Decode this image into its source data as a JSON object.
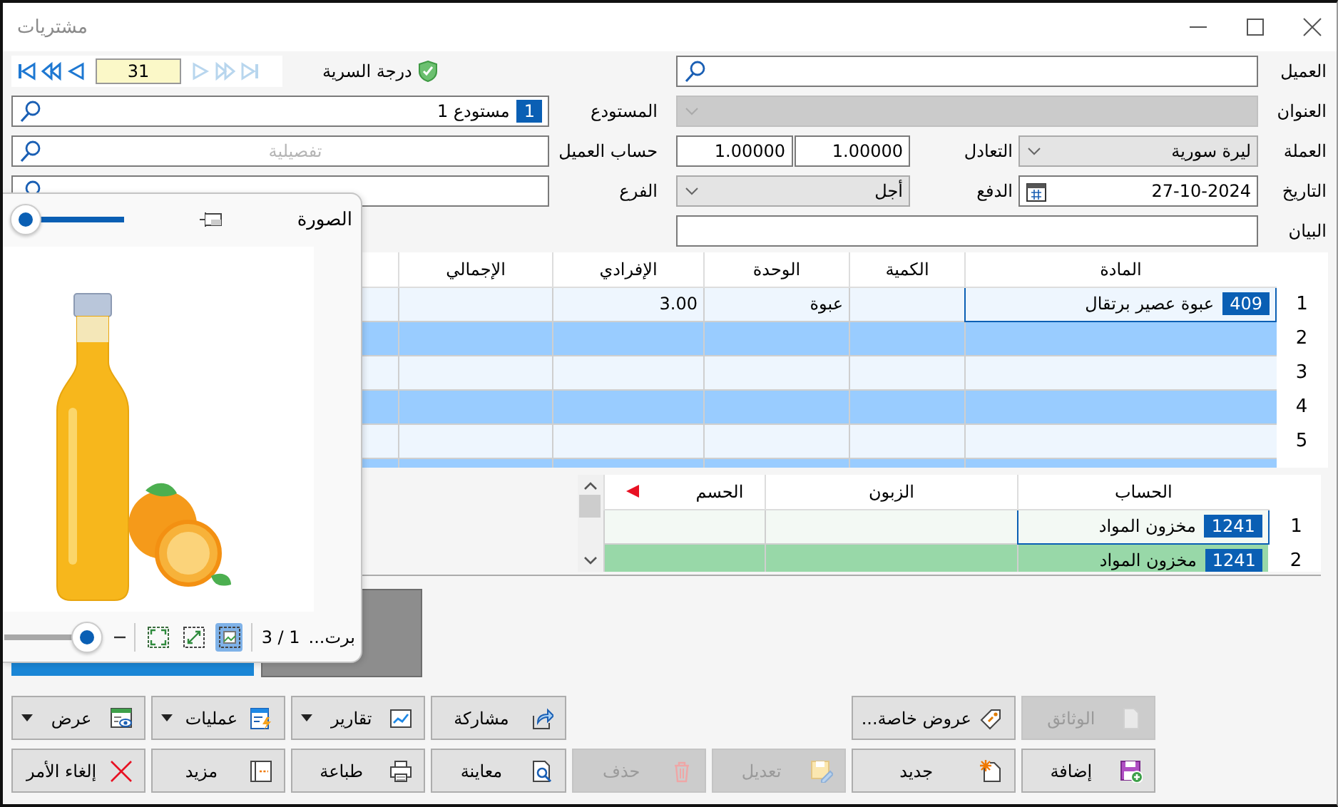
{
  "window": {
    "title": "مشتريات"
  },
  "navigator": {
    "record": "31",
    "back_disabled": false,
    "forward_disabled": true
  },
  "security": {
    "label": "درجة السرية"
  },
  "left_fields": [
    {
      "kind": "lookup",
      "label": "المستودع",
      "badge": "1",
      "value": "مستودع 1"
    },
    {
      "kind": "lookup",
      "label": "حساب العميل",
      "placeholder": "تفصيلية"
    },
    {
      "kind": "lookup",
      "label": "الفرع"
    }
  ],
  "right_rows": [
    {
      "fields": [
        {
          "kind": "lookup",
          "label": "العميل"
        }
      ]
    },
    {
      "fields": [
        {
          "kind": "combo",
          "label": "العنوان",
          "disabled": true
        }
      ]
    },
    {
      "fields": [
        {
          "kind": "combo",
          "label": "العملة",
          "value": "ليرة سورية",
          "disabled": false
        },
        {
          "kind": "pair",
          "label": "التعادل",
          "values": [
            "1.00000",
            "1.00000"
          ]
        }
      ]
    },
    {
      "fields": [
        {
          "kind": "date",
          "label": "التاريخ",
          "value": "27-10-2024"
        },
        {
          "kind": "combo",
          "label": "الدفع",
          "value": "أجل",
          "disabled": false
        }
      ]
    },
    {
      "fields": [
        {
          "kind": "text",
          "label": "البيان"
        }
      ]
    }
  ],
  "items_table": {
    "columns": [
      "المادة",
      "الكمية",
      "الوحدة",
      "الإفرادي",
      "الإجمالي"
    ],
    "rows": [
      {
        "number": "1",
        "selected": true,
        "item": {
          "code": "409",
          "name": "عبوة عصير برتقال"
        },
        "unit": "عبوة",
        "unit_price": "3.00"
      },
      {
        "number": "2",
        "selected": false
      },
      {
        "number": "3",
        "selected": false
      },
      {
        "number": "4",
        "selected": false
      },
      {
        "number": "5",
        "selected": false
      }
    ]
  },
  "accounts_table": {
    "columns": [
      {
        "label": "الحساب",
        "marked": false
      },
      {
        "label": "الزبون",
        "marked": false
      },
      {
        "label": "الحسم",
        "marked": true
      }
    ],
    "rows": [
      {
        "number": "1",
        "selected": true,
        "account": {
          "code": "1241",
          "name": "مخزون المواد"
        }
      },
      {
        "number": "2",
        "selected": false,
        "account": {
          "code": "1241",
          "name": "مخزون المواد"
        }
      }
    ]
  },
  "image_panel": {
    "title": "الصورة",
    "zoom": {
      "level": 0.88
    },
    "caption": "برت...",
    "counter": "1 / 3",
    "view_modes": [
      {
        "selected": false
      },
      {
        "selected": false
      },
      {
        "selected": true
      }
    ],
    "size": {
      "level": 0.15
    }
  },
  "buttons": {
    "row_1_right": [
      {
        "label": "الوثائق",
        "disabled": true,
        "menu": false
      },
      {
        "label": "عروض خاصة...",
        "disabled": false,
        "menu": false
      }
    ],
    "row_1_left": [
      {
        "label": "مشاركة",
        "disabled": false,
        "menu": false
      },
      {
        "label": "تقارير",
        "disabled": false,
        "menu": true
      },
      {
        "label": "عمليات",
        "disabled": false,
        "menu": true
      },
      {
        "label": "عرض",
        "disabled": false,
        "menu": true
      }
    ],
    "row_2": [
      {
        "label": "إضافة",
        "disabled": false,
        "menu": false
      },
      {
        "label": "جديد",
        "disabled": false,
        "menu": false
      },
      {
        "label": "تعديل",
        "disabled": true,
        "menu": false
      },
      {
        "label": "حذف",
        "disabled": true,
        "menu": false
      },
      {
        "label": "معاينة",
        "disabled": false,
        "menu": false
      },
      {
        "label": "طباعة",
        "disabled": false,
        "menu": false
      },
      {
        "label": "مزيد",
        "disabled": false,
        "menu": false
      },
      {
        "label": "إلغاء الأمر",
        "disabled": false,
        "menu": false
      }
    ]
  }
}
